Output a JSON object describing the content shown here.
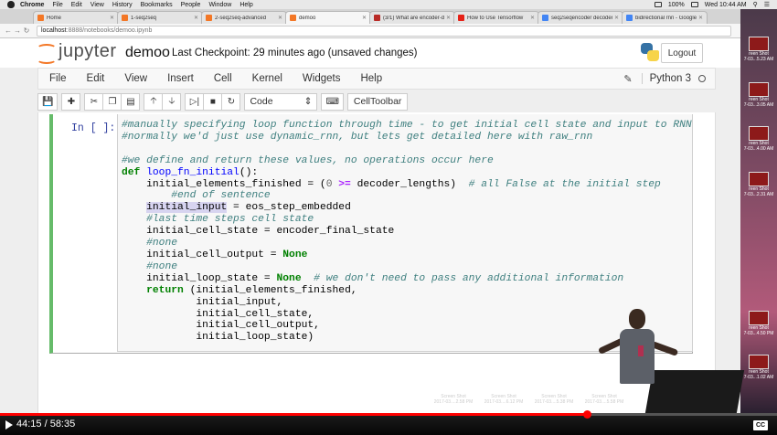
{
  "mac_menubar": {
    "app": "Chrome",
    "menus": [
      "File",
      "Edit",
      "View",
      "History",
      "Bookmarks",
      "People",
      "Window",
      "Help"
    ],
    "battery": "100%",
    "clock": "Wed 10:44 AM"
  },
  "tabs": [
    {
      "label": "Home",
      "favicon": "jupyter-icon",
      "active": false
    },
    {
      "label": "1-seq2seq",
      "favicon": "jupyter-icon",
      "active": false
    },
    {
      "label": "2-seq2seq-advanced",
      "favicon": "jupyter-icon",
      "active": false
    },
    {
      "label": "demoo",
      "favicon": "jupyter-icon",
      "active": true
    },
    {
      "label": "(3/1) What are encoder-de",
      "favicon": "quora-icon",
      "active": false
    },
    {
      "label": "How to Use Tensorflow",
      "favicon": "youtube-icon",
      "active": false
    },
    {
      "label": "seq2seqencoder decoder",
      "favicon": "google-icon",
      "active": false
    },
    {
      "label": "bidirectional rnn - Google S",
      "favicon": "google-icon",
      "active": false
    }
  ],
  "url": {
    "host": "localhost",
    "path": ":8888/notebooks/demoo.ipynb"
  },
  "header": {
    "brand": "jupyter",
    "notebook_name": "demoo",
    "checkpoint": "Last Checkpoint: 29 minutes ago (unsaved changes)",
    "logout_label": "Logout"
  },
  "menu": {
    "items": [
      "File",
      "Edit",
      "View",
      "Insert",
      "Cell",
      "Kernel",
      "Widgets",
      "Help"
    ],
    "kernel_name": "Python 3"
  },
  "toolbar": {
    "cell_type": "Code",
    "celltoolbar_label": "CellToolbar"
  },
  "cell": {
    "prompt": "In [ ]:",
    "lines": [
      "#manually specifying loop function through time - to get initial cell state and input to RNN",
      "#normally we'd just use dynamic_rnn, but lets get detailed here with raw_rnn",
      "",
      "#we define and return these values, no operations occur here",
      "def loop_fn_initial():",
      "    initial_elements_finished = (0 >= decoder_lengths)  # all False at the initial step",
      "    #end of sentence",
      "    initial_input = eos_step_embedded",
      "    #last time steps cell state",
      "    initial_cell_state = encoder_final_state",
      "    #none",
      "    initial_cell_output = None",
      "    #none",
      "    initial_loop_state = None  # we don't need to pass any additional information",
      "    return (initial_elements_finished,",
      "            initial_input,",
      "            initial_cell_state,",
      "            initial_cell_output,",
      "            initial_loop_state)"
    ]
  },
  "desktop_thumbs": [
    {
      "label1": "reen Shot",
      "label2": "7-03...5.23 AM"
    },
    {
      "label1": "reen Shot",
      "label2": "7-03...3.05 AM"
    },
    {
      "label1": "reen Shot",
      "label2": "7-03...4.00 AM"
    },
    {
      "label1": "reen Shot",
      "label2": "7-03...2.31 AM"
    },
    {
      "label1": "reen Shot",
      "label2": "7-03...4.50 PM"
    },
    {
      "label1": "reen Shot",
      "label2": "7-03...1.02 AM"
    }
  ],
  "dock_items": [
    {
      "label1": "Screen Shot",
      "label2": "2017-03....2.58 PM"
    },
    {
      "label1": "Screen Shot",
      "label2": "2017-03....6.12 PM"
    },
    {
      "label1": "Screen Shot",
      "label2": "2017-03....5.38 PM"
    },
    {
      "label1": "Screen Shot",
      "label2": "2017-03....5.58 PM"
    }
  ],
  "player": {
    "time": "44:15 / 58:35",
    "progress_fraction": 0.755,
    "captions_label": "CC"
  }
}
